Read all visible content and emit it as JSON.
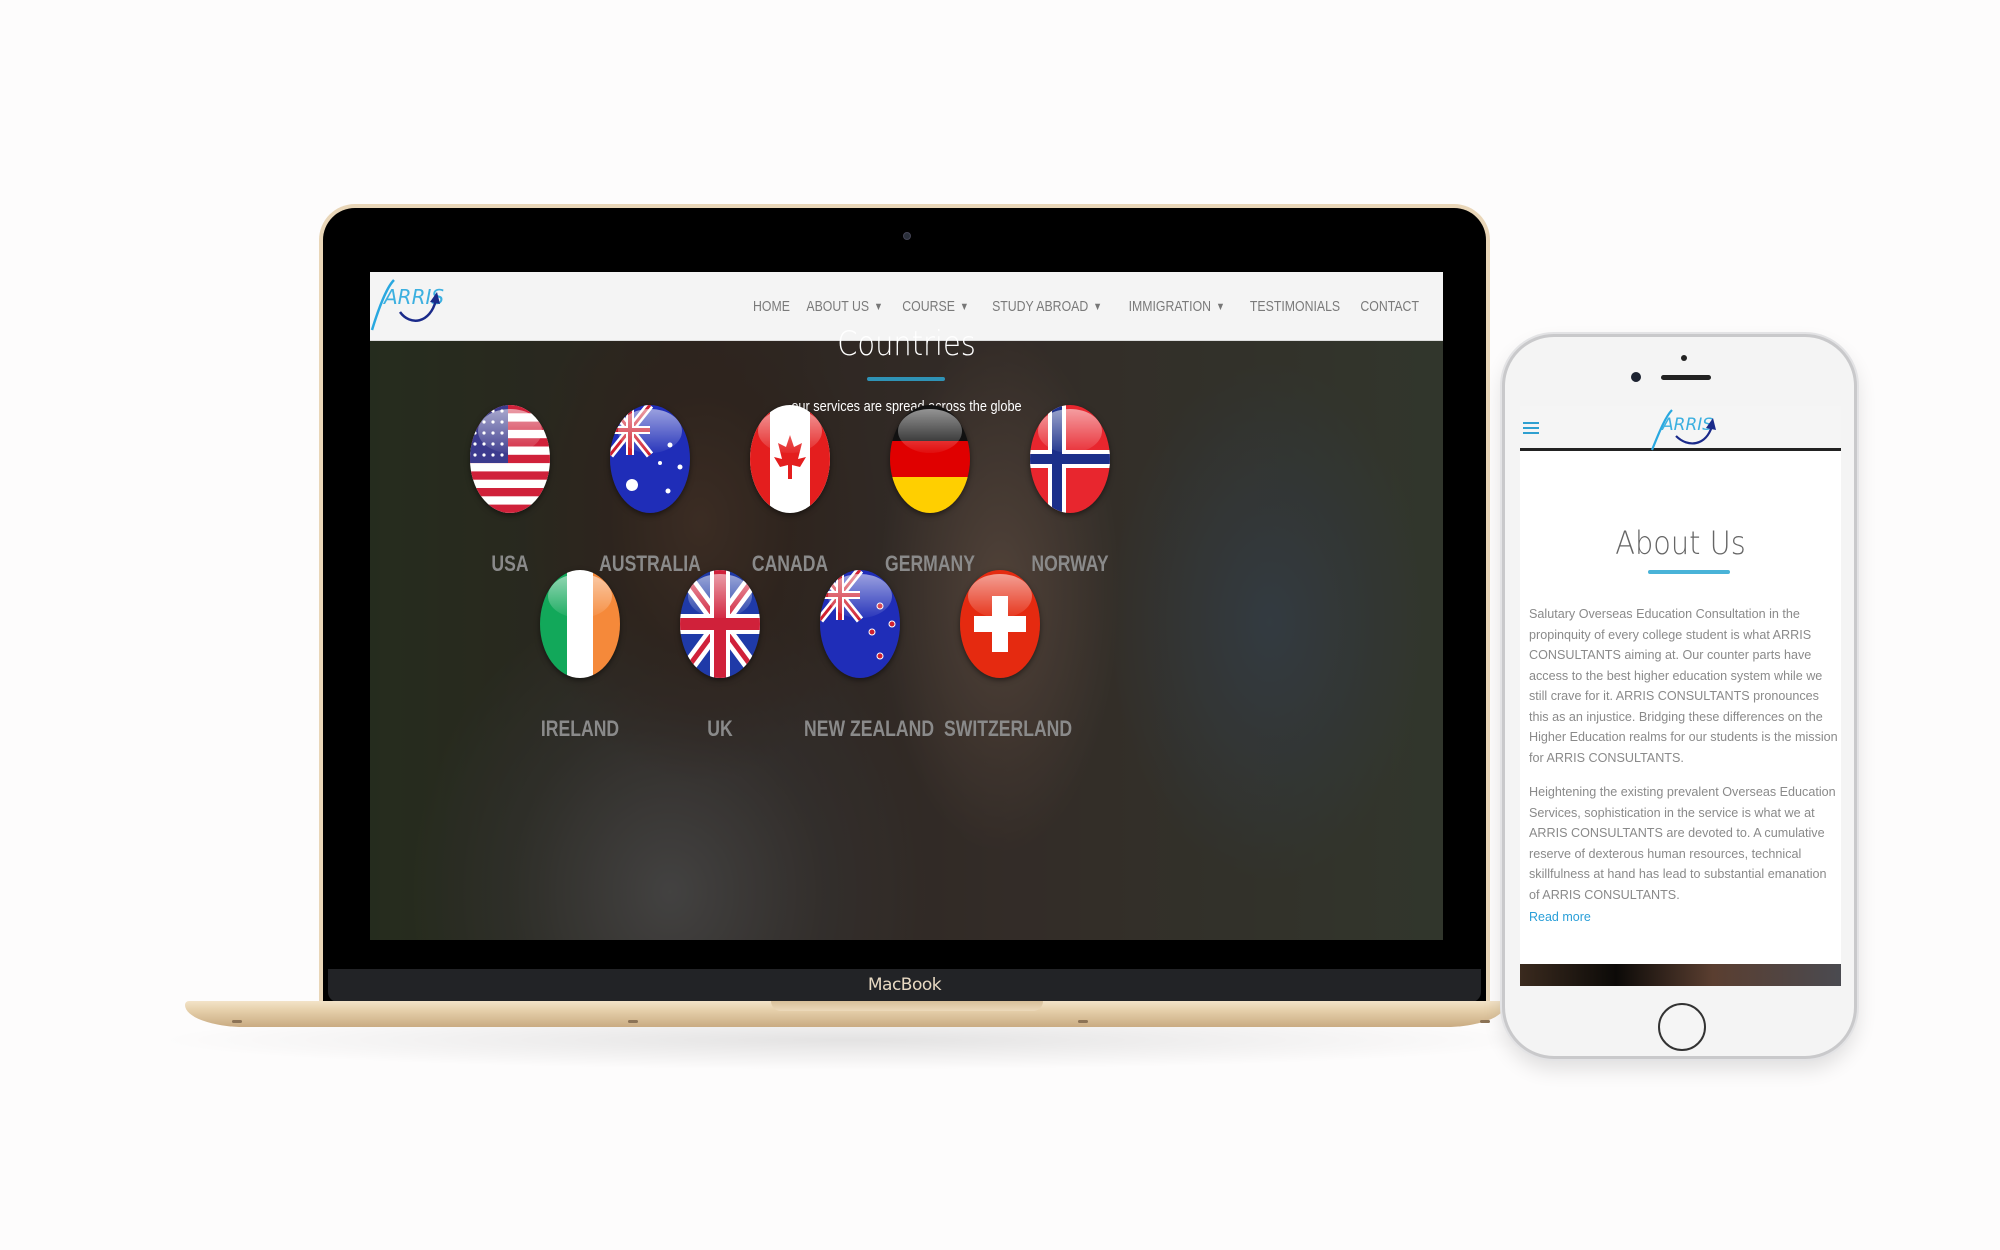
{
  "laptop": {
    "brand_label": "MacBook",
    "site": {
      "logo_text": "ARRIS",
      "nav": [
        {
          "label": "HOME",
          "dropdown": false
        },
        {
          "label": "ABOUT US",
          "dropdown": true
        },
        {
          "label": "COURSE",
          "dropdown": true
        },
        {
          "label": "STUDY ABROAD",
          "dropdown": true
        },
        {
          "label": "IMMIGRATION",
          "dropdown": true
        },
        {
          "label": "TESTIMONIALS",
          "dropdown": false
        },
        {
          "label": "CONTACT",
          "dropdown": false
        }
      ],
      "caret_glyph": "▼",
      "section": {
        "title": "Countries",
        "subtitle": "our services are spread across the globe",
        "accent_color": "#2f93b6"
      },
      "countries": [
        {
          "name": "USA",
          "flag": "usa-flag"
        },
        {
          "name": "AUSTRALIA",
          "flag": "australia-flag"
        },
        {
          "name": "CANADA",
          "flag": "canada-flag"
        },
        {
          "name": "GERMANY",
          "flag": "germany-flag"
        },
        {
          "name": "NORWAY",
          "flag": "norway-flag"
        },
        {
          "name": "IRELAND",
          "flag": "ireland-flag"
        },
        {
          "name": "UK",
          "flag": "uk-flag"
        },
        {
          "name": "NEW ZEALAND",
          "flag": "new-zealand-flag"
        },
        {
          "name": "SWITZERLAND",
          "flag": "switzerland-flag"
        }
      ]
    }
  },
  "phone": {
    "site": {
      "logo_text": "ARRIS",
      "menu_icon": "hamburger-icon",
      "title": "About Us",
      "paragraphs": [
        "Salutary Overseas Education Consultation in the propinquity of every college student is what ARRIS CONSULTANTS aiming at. Our counter parts have access to the best higher education system while we still crave for it. ARRIS CONSULTANTS pronounces this as an injustice. Bridging these differences on the Higher Education realms for our students is the mission for ARRIS CONSULTANTS.",
        "Heightening the existing prevalent Overseas Education Services, sophistication in the service is what we at ARRIS CONSULTANTS are devoted to. A cumulative reserve of dexterous human resources, technical skillfulness at hand has lead to substantial emanation of ARRIS CONSULTANTS."
      ],
      "read_more": "Read more",
      "link_color": "#2a9fd8"
    }
  }
}
